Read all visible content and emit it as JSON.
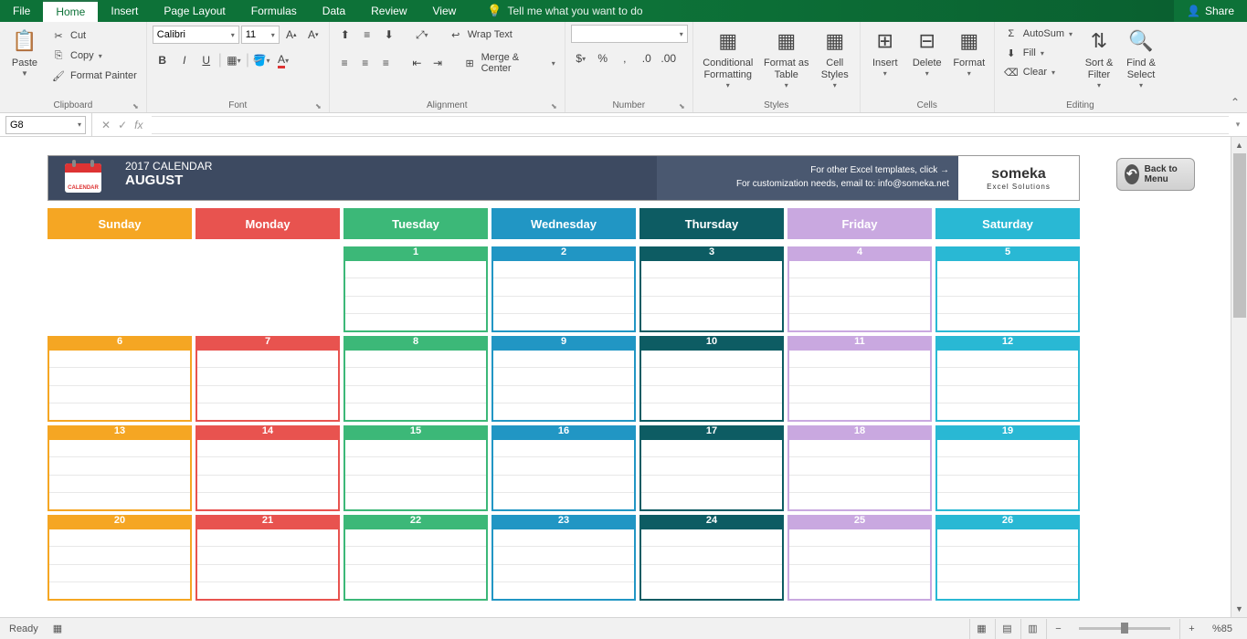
{
  "titlebar": {
    "tabs": [
      "File",
      "Home",
      "Insert",
      "Page Layout",
      "Formulas",
      "Data",
      "Review",
      "View"
    ],
    "active": "Home",
    "tell": "Tell me what you want to do",
    "share": "Share"
  },
  "ribbon": {
    "clipboard": {
      "label": "Clipboard",
      "paste": "Paste",
      "cut": "Cut",
      "copy": "Copy",
      "painter": "Format Painter"
    },
    "font": {
      "label": "Font",
      "name": "Calibri",
      "size": "11"
    },
    "alignment": {
      "label": "Alignment",
      "wrap": "Wrap Text",
      "merge": "Merge & Center"
    },
    "number": {
      "label": "Number",
      "format": ""
    },
    "styles": {
      "label": "Styles",
      "cond": "Conditional Formatting",
      "table": "Format as Table",
      "cell": "Cell Styles"
    },
    "cells": {
      "label": "Cells",
      "insert": "Insert",
      "delete": "Delete",
      "format": "Format"
    },
    "editing": {
      "label": "Editing",
      "autosum": "AutoSum",
      "fill": "Fill",
      "clear": "Clear",
      "sort": "Sort & Filter",
      "find": "Find & Select"
    }
  },
  "formula": {
    "ref": "G8"
  },
  "calendar": {
    "year": "2017 CALENDAR",
    "month": "AUGUST",
    "info1": "For other Excel templates, click →",
    "info2": "For customization needs, email to: info@someka.net",
    "brand": "someka",
    "brand_sub": "Excel Solutions",
    "back": "Back to Menu",
    "days": [
      "Sunday",
      "Monday",
      "Tuesday",
      "Wednesday",
      "Thursday",
      "Friday",
      "Saturday"
    ],
    "weeks": [
      [
        "",
        "",
        "1",
        "2",
        "3",
        "4",
        "5"
      ],
      [
        "6",
        "7",
        "8",
        "9",
        "10",
        "11",
        "12"
      ],
      [
        "13",
        "14",
        "15",
        "16",
        "17",
        "18",
        "19"
      ],
      [
        "20",
        "21",
        "22",
        "23",
        "24",
        "25",
        "26"
      ]
    ]
  },
  "status": {
    "ready": "Ready",
    "zoom": "%85"
  }
}
